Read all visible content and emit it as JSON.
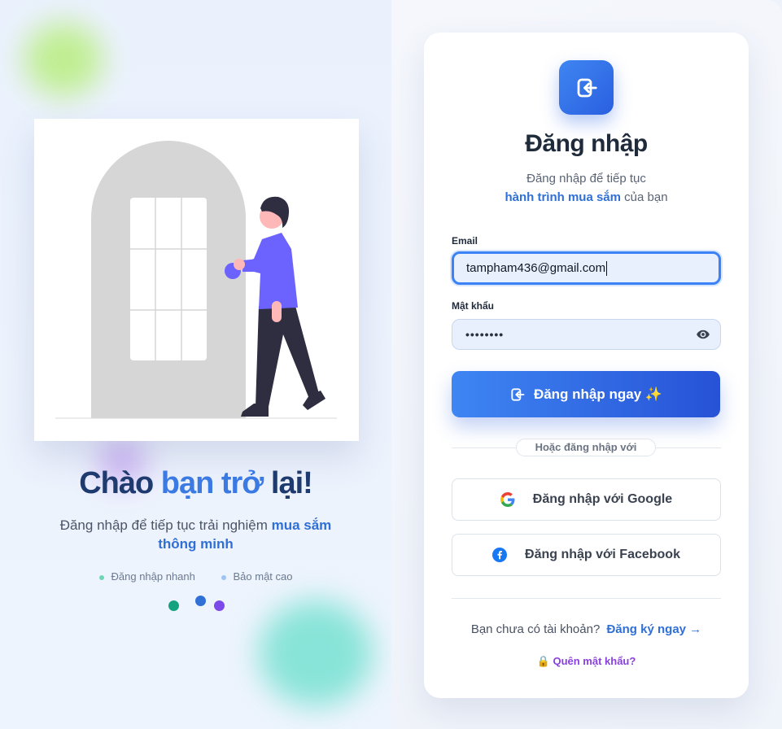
{
  "colors": {
    "primary": "#2f6fd6",
    "primary_gradient_start": "#3e86f3",
    "primary_gradient_end": "#2752d6",
    "title_dark": "#1e3a6e",
    "forgot_purple": "#8b3fe0",
    "illustration_person_shirt": "#6c63ff"
  },
  "welcome": {
    "title_part1": "Chào ",
    "title_accent": "bạn trở",
    "title_part2": " lại!",
    "subtitle_text": "Đăng nhập để tiếp tục trải nghiệm ",
    "subtitle_accent": "mua sắm thông minh",
    "features": [
      {
        "label": "Đăng nhập nhanh",
        "dot_color": "#6fd6b5"
      },
      {
        "label": "Bảo mật cao",
        "dot_color": "#9ec3f5"
      }
    ],
    "deco_dots": [
      "#14a37f",
      "#2f6fd6",
      "#7c4ae8"
    ]
  },
  "card": {
    "logo_icon": "login-arrow-icon",
    "title": "Đăng nhập",
    "subtitle_line1": "Đăng nhập để tiếp tục",
    "subtitle_accent": "hành trình mua sắm",
    "subtitle_rest": " của bạn",
    "email": {
      "label": "Email",
      "value": "tampham436@gmail.com"
    },
    "password": {
      "label": "Mật khẩu",
      "value": "••••••••",
      "toggle_icon": "eye-icon"
    },
    "submit_label": "Đăng nhập ngay ✨",
    "divider_text": "Hoặc đăng nhập với",
    "google_label": "Đăng nhập với Google",
    "facebook_label": "Đăng nhập với Facebook",
    "signup_prompt": "Bạn chưa có tài khoản?",
    "signup_link": "Đăng ký ngay →",
    "forgot_icon": "🔒",
    "forgot_label": "Quên mật khẩu?"
  }
}
